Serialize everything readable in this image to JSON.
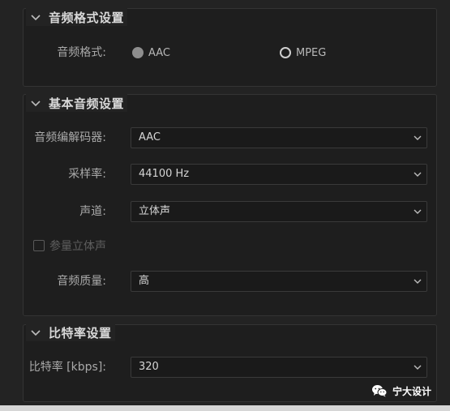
{
  "sections": {
    "audio_format": {
      "title": "音频格式设置",
      "label": "音频格式:",
      "options": [
        "AAC",
        "MPEG"
      ],
      "selected": "AAC"
    },
    "basic_audio": {
      "title": "基本音频设置",
      "codec_label": "音频编解码器:",
      "codec_value": "AAC",
      "sample_rate_label": "采样率:",
      "sample_rate_value": "44100 Hz",
      "channels_label": "声道:",
      "channels_value": "立体声",
      "param_stereo_label": "参量立体声",
      "param_stereo_checked": false,
      "quality_label": "音频质量:",
      "quality_value": "高"
    },
    "bitrate": {
      "title": "比特率设置",
      "label": "比特率 [kbps]:",
      "value": "320"
    }
  },
  "watermark": {
    "text": "宁大设计",
    "icon": "wechat-icon"
  },
  "colors": {
    "background": "#232323",
    "panel": "#1e1e1e",
    "text": "#bdbdbd",
    "bottom_bar": "#d6d6d6"
  }
}
